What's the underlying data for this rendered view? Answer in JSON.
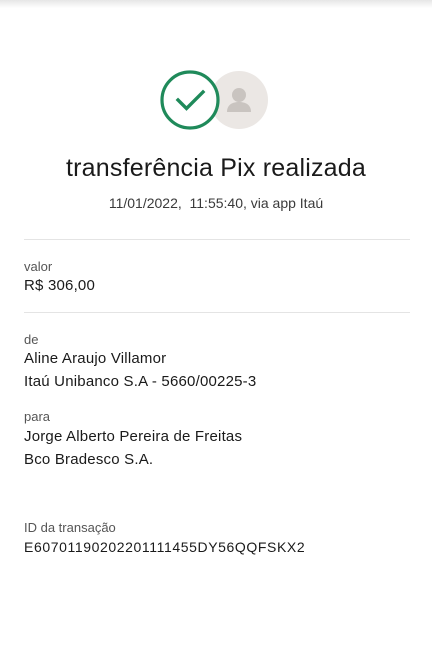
{
  "header": {
    "title": "transferência Pix realizada",
    "datetime": "11/01/2022,  11:55:40, via app Itaú"
  },
  "icons": {
    "status": "check-circle-icon",
    "recipient": "user-avatar-icon"
  },
  "colors": {
    "success_green": "#1f8a5a",
    "avatar_bg": "#ebe7e4",
    "avatar_fg": "#c9c4c0"
  },
  "amount": {
    "label": "valor",
    "value": "R$ 306,00"
  },
  "sender": {
    "label": "de",
    "name": "Aline Araujo Villamor",
    "bank": "Itaú Unibanco S.A - 5660/00225-3"
  },
  "recipient": {
    "label": "para",
    "name": "Jorge Alberto Pereira de Freitas",
    "bank": "Bco Bradesco S.A."
  },
  "transaction": {
    "label": "ID da transação",
    "id": "E60701190202201111455DY56QQFSKX2"
  }
}
